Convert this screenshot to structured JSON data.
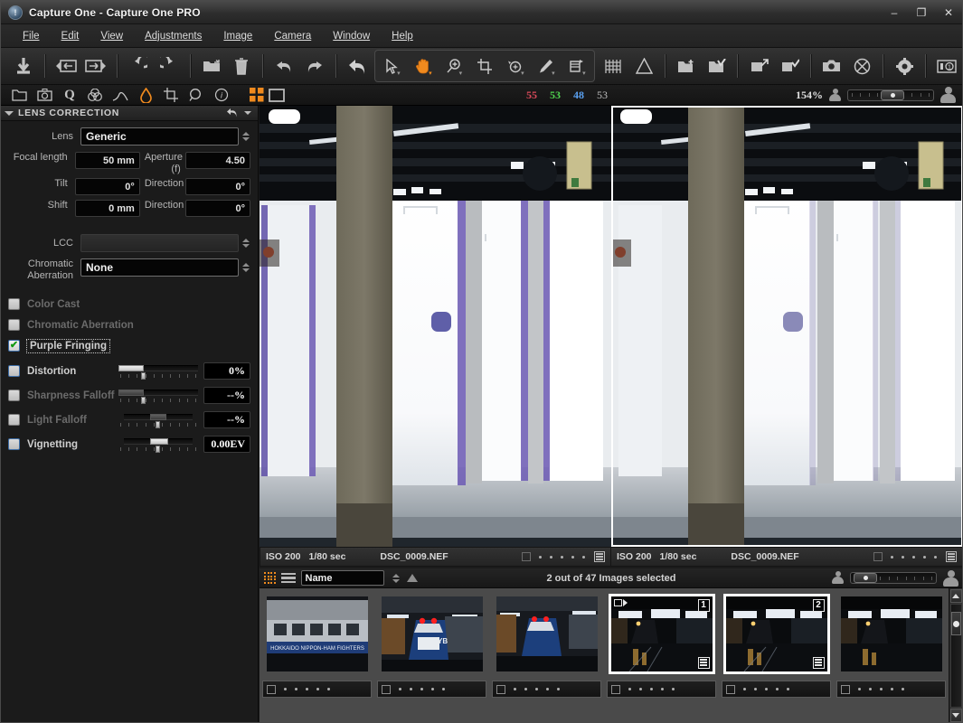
{
  "window": {
    "app_icon": "capture-one-logo-icon",
    "title": "Capture One - Capture One PRO",
    "minimize_label": "–",
    "maximize_label": "❐",
    "close_label": "✕"
  },
  "menubar": {
    "items": [
      {
        "label": "File"
      },
      {
        "label": "Edit"
      },
      {
        "label": "View"
      },
      {
        "label": "Adjustments"
      },
      {
        "label": "Image"
      },
      {
        "label": "Camera"
      },
      {
        "label": "Window"
      },
      {
        "label": "Help"
      }
    ]
  },
  "main_toolbar": {
    "groups": [
      {
        "tools": [
          {
            "name": "import-download-icon",
            "glyph": "⬇"
          }
        ]
      },
      {
        "tools": [
          {
            "name": "previous-image-icon",
            "glyph": "◁▭"
          },
          {
            "name": "next-image-icon",
            "glyph": "▭▷"
          }
        ]
      },
      {
        "tools": [
          {
            "name": "rotate-left-icon",
            "glyph": "↺"
          },
          {
            "name": "rotate-right-icon",
            "glyph": "↻"
          }
        ]
      },
      {
        "tools": [
          {
            "name": "open-folder-icon",
            "glyph": "📁"
          },
          {
            "name": "trash-icon",
            "glyph": "🗑"
          }
        ]
      },
      {
        "tools": [
          {
            "name": "undo-icon",
            "glyph": "↶"
          },
          {
            "name": "redo-icon",
            "glyph": "↷"
          }
        ]
      },
      {
        "tools": [
          {
            "name": "reset-adjustments-icon",
            "glyph": "↩"
          }
        ]
      },
      {
        "tools": [
          {
            "name": "select-cursor-tool-icon",
            "glyph": "➤",
            "active": false
          },
          {
            "name": "pan-hand-tool-icon",
            "glyph": "✋",
            "active": true
          },
          {
            "name": "zoom-tool-icon",
            "glyph": "⌕",
            "active": false
          },
          {
            "name": "crop-tool-icon",
            "glyph": "⧉",
            "active": false
          },
          {
            "name": "rotate-tool-icon",
            "glyph": "↻",
            "active": false
          },
          {
            "name": "draw-pen-tool-icon",
            "glyph": "✐",
            "active": false
          },
          {
            "name": "keystone-tool-icon",
            "glyph": "◱",
            "active": false
          }
        ]
      },
      {
        "tools": [
          {
            "name": "grid-overlay-icon",
            "glyph": "▒"
          },
          {
            "name": "exposure-warning-icon",
            "glyph": "⚠"
          }
        ]
      },
      {
        "tools": [
          {
            "name": "new-album-icon",
            "glyph": "⊕"
          },
          {
            "name": "select-album-icon",
            "glyph": "✓"
          }
        ]
      },
      {
        "tools": [
          {
            "name": "process-export-icon",
            "glyph": "↗"
          },
          {
            "name": "process-recipe-icon",
            "glyph": "✓"
          }
        ]
      },
      {
        "tools": [
          {
            "name": "capture-camera-icon",
            "glyph": "📷"
          },
          {
            "name": "stop-capture-icon",
            "glyph": "⊗"
          }
        ]
      },
      {
        "tools": [
          {
            "name": "preferences-gear-icon",
            "glyph": "⚙"
          }
        ]
      },
      {
        "tools": [
          {
            "name": "camera-settings-icon",
            "glyph": "◫"
          }
        ]
      }
    ]
  },
  "tool_tabs": {
    "items": [
      {
        "name": "tab-library",
        "glyph": "▱",
        "selected": false
      },
      {
        "name": "tab-capture",
        "glyph": "◎",
        "selected": false
      },
      {
        "name": "tab-quick",
        "glyph": "Q",
        "selected": false
      },
      {
        "name": "tab-color",
        "glyph": "◎",
        "selected": false
      },
      {
        "name": "tab-exposure",
        "glyph": "△",
        "selected": false
      },
      {
        "name": "tab-lens-correction",
        "glyph": "●",
        "selected": true
      },
      {
        "name": "tab-composition",
        "glyph": "⧉",
        "selected": false
      },
      {
        "name": "tab-details",
        "glyph": "⌕",
        "selected": false
      },
      {
        "name": "tab-metadata",
        "glyph": "ⓘ",
        "selected": false
      }
    ],
    "view_modes": [
      {
        "name": "multi-view-mode-button",
        "selected": true
      },
      {
        "name": "single-view-mode-button",
        "selected": false
      }
    ]
  },
  "readout": {
    "r": "55",
    "g": "53",
    "b": "48",
    "l": "53",
    "r_color": "#d94a5a",
    "g_color": "#4fd44f",
    "b_color": "#5aa0f0",
    "l_color": "#bdbdbd",
    "zoom_level": "154%"
  },
  "lens_correction": {
    "panel_title": "LENS CORRECTION",
    "reset_icon": "reset-arrow-icon",
    "menu_icon": "chevron-down-icon",
    "collapse_icon": "caret-down-icon",
    "lens_label": "Lens",
    "lens_value": "Generic",
    "focal_length_label": "Focal length",
    "focal_length_value": "50 mm",
    "aperture_label": "Aperture (f)",
    "aperture_value": "4.50",
    "tilt_label": "Tilt",
    "tilt_value": "0°",
    "tilt_direction_label": "Direction",
    "tilt_direction_value": "0°",
    "shift_label": "Shift",
    "shift_value": "0 mm",
    "shift_direction_label": "Direction",
    "shift_direction_value": "0°",
    "lcc_label": "LCC",
    "lcc_value": "",
    "chromatic_aberration_label": "Chromatic Aberration",
    "chromatic_aberration_value": "None",
    "checkboxes": [
      {
        "name": "color-cast-checkbox",
        "label": "Color Cast",
        "checked": false,
        "enabled": false
      },
      {
        "name": "chromatic-aberration-checkbox",
        "label": "Chromatic Aberration",
        "checked": false,
        "enabled": false
      },
      {
        "name": "purple-fringing-checkbox",
        "label": "Purple Fringing",
        "checked": true,
        "enabled": true,
        "focused": true
      }
    ],
    "sliders": [
      {
        "name": "distortion-slider",
        "label": "Distortion",
        "checked": false,
        "enabled": true,
        "value": "0%",
        "fill_pct": 32,
        "handle_pct": 32,
        "fill_grey": false
      },
      {
        "name": "sharpness-falloff-slider",
        "label": "Sharpness Falloff",
        "checked": false,
        "enabled": false,
        "value": "--%",
        "fill_pct": 32,
        "handle_pct": 32,
        "fill_grey": true
      },
      {
        "name": "light-falloff-slider",
        "label": "Light Falloff",
        "checked": false,
        "enabled": false,
        "value": "--%",
        "fill_pct": 72,
        "handle_pct": 48,
        "fill_grey": true
      },
      {
        "name": "vignetting-slider",
        "label": "Vignetting",
        "checked": false,
        "enabled": true,
        "value": "0.00EV",
        "fill_pct": 50,
        "handle_pct": 48,
        "fill_grey": false
      }
    ]
  },
  "viewer": {
    "panes": [
      {
        "name": "image-pane-left",
        "selected": false,
        "iso": "ISO 200",
        "shutter": "1/80 sec",
        "filename": "DSC_0009.NEF"
      },
      {
        "name": "image-pane-right",
        "selected": true,
        "iso": "ISO 200",
        "shutter": "1/80 sec",
        "filename": "DSC_0009.NEF"
      }
    ]
  },
  "browser_bar": {
    "grid_view_icon": "grid-view-icon",
    "list_view_icon": "list-view-icon",
    "sort_value": "Name",
    "sort_direction_icon": "sort-ascending-icon",
    "selection_status": "2 out of 47 Images selected"
  },
  "filmstrip": {
    "thumbnails": [
      {
        "name": "thumbnail-1",
        "selected": false,
        "primary": false,
        "badge": "",
        "scene": "train-side-banner"
      },
      {
        "name": "thumbnail-2",
        "selected": false,
        "primary": false,
        "badge": "",
        "scene": "train-front-blue"
      },
      {
        "name": "thumbnail-3",
        "selected": false,
        "primary": false,
        "badge": "",
        "scene": "train-front-blue"
      },
      {
        "name": "thumbnail-4",
        "selected": true,
        "primary": true,
        "badge": "1",
        "scene": "train-dark-platform"
      },
      {
        "name": "thumbnail-5",
        "selected": true,
        "primary": false,
        "badge": "2",
        "scene": "train-dark-platform"
      },
      {
        "name": "thumbnail-6",
        "selected": false,
        "primary": false,
        "badge": "",
        "scene": "train-dark-platform"
      }
    ],
    "rating_rows": [
      {
        "name": "rating-strip-1"
      },
      {
        "name": "rating-strip-2"
      },
      {
        "name": "rating-strip-3"
      },
      {
        "name": "rating-strip-4"
      },
      {
        "name": "rating-strip-5"
      },
      {
        "name": "rating-strip-6"
      }
    ],
    "scroll_up_icon": "scroll-up-arrow-icon",
    "scroll_down_icon": "scroll-down-arrow-icon"
  },
  "colors": {
    "accent": "#f08a1e",
    "panel_bg": "#1b1b1b",
    "toolbar_bg": "#2b2b2b",
    "filmstrip_bg": "#4a4a4a"
  }
}
